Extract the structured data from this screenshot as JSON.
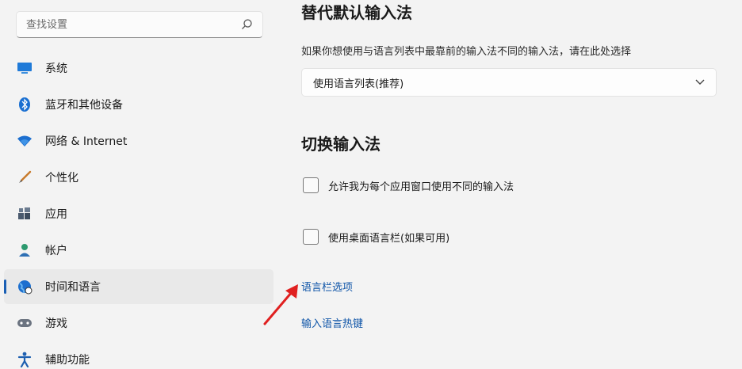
{
  "sidebar": {
    "search_placeholder": "查找设置",
    "items": [
      {
        "label": "系统",
        "icon": "monitor-icon"
      },
      {
        "label": "蓝牙和其他设备",
        "icon": "bluetooth-icon"
      },
      {
        "label": "网络 & Internet",
        "icon": "wifi-icon"
      },
      {
        "label": "个性化",
        "icon": "brush-icon"
      },
      {
        "label": "应用",
        "icon": "apps-icon"
      },
      {
        "label": "帐户",
        "icon": "person-icon"
      },
      {
        "label": "时间和语言",
        "icon": "globe-clock-icon",
        "active": true
      },
      {
        "label": "游戏",
        "icon": "gamepad-icon"
      },
      {
        "label": "辅助功能",
        "icon": "accessibility-icon"
      }
    ]
  },
  "main": {
    "override_section": {
      "title": "替代默认输入法",
      "description": "如果你想使用与语言列表中最靠前的输入法不同的输入法，请在此处选择",
      "select_value": "使用语言列表(推荐)"
    },
    "switch_section": {
      "title": "切换输入法",
      "checkboxes": [
        {
          "label": "允许我为每个应用窗口使用不同的输入法",
          "checked": false
        },
        {
          "label": "使用桌面语言栏(如果可用)",
          "checked": false
        }
      ],
      "links": [
        {
          "label": "语言栏选项"
        },
        {
          "label": "输入语言热键"
        }
      ]
    }
  },
  "colors": {
    "accent": "#1a5fb4",
    "link": "#0f55a8",
    "annotation_arrow": "#e02020"
  }
}
